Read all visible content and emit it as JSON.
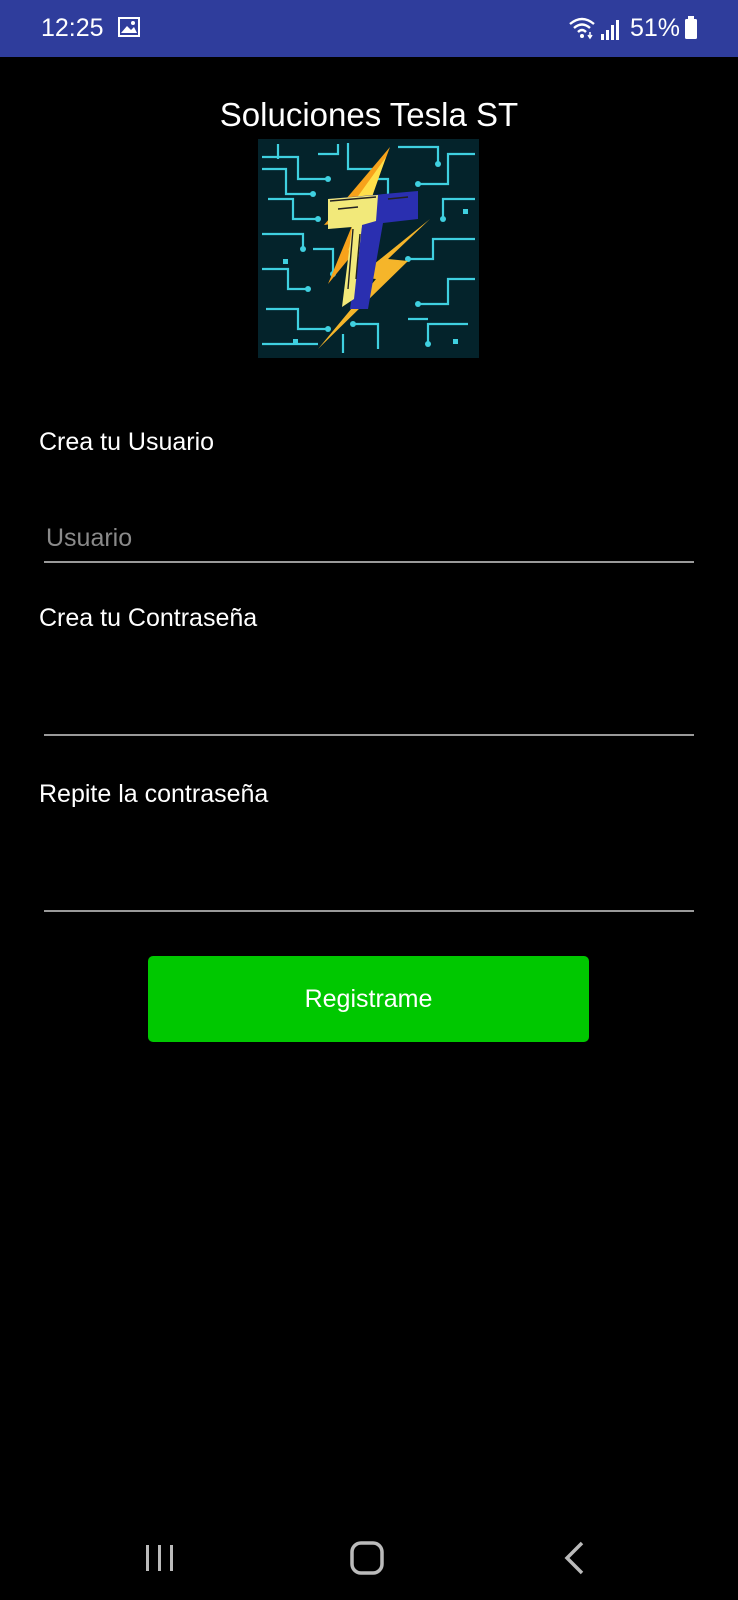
{
  "status_bar": {
    "time": "12:25",
    "battery_text": "51%",
    "icons": [
      "image-icon",
      "wifi-icon",
      "signal-icon",
      "battery-icon"
    ]
  },
  "header": {
    "title": "Soluciones Tesla ST",
    "logo_icon": "circuit-lightning-t-logo"
  },
  "form": {
    "user_label": "Crea tu Usuario",
    "user_placeholder": "Usuario",
    "user_value": "",
    "password_label": "Crea tu Contraseña",
    "password_value": "",
    "repeat_label": "Repite la contraseña",
    "repeat_value": "",
    "submit_label": "Registrame"
  },
  "nav_bar": {
    "icons": [
      "recents-icon",
      "home-icon",
      "back-icon"
    ]
  },
  "colors": {
    "status_bar": "#2f3d9c",
    "background": "#000000",
    "button": "#00c800",
    "underline": "#9a9a9a",
    "placeholder": "#8a8a8a"
  }
}
